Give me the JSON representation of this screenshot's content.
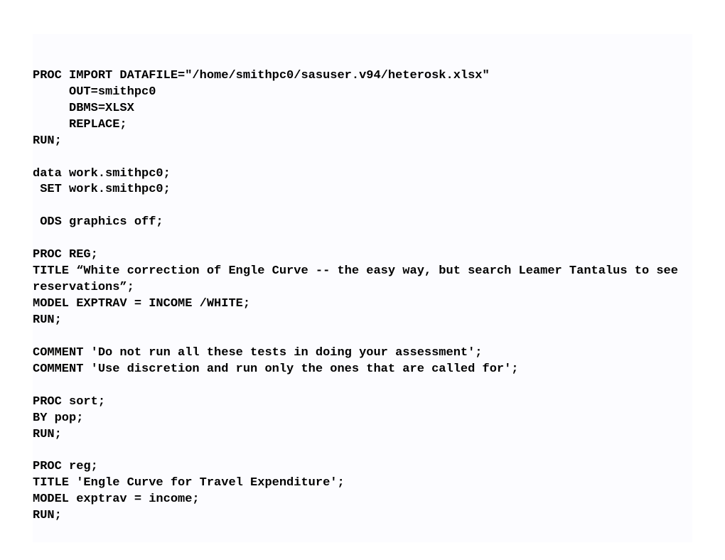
{
  "code": {
    "lines": [
      "PROC IMPORT DATAFILE=\"/home/smithpc0/sasuser.v94/heterosk.xlsx\"",
      "     OUT=smithpc0",
      "     DBMS=XLSX",
      "     REPLACE;",
      "RUN;",
      "",
      "data work.smithpc0;",
      " SET work.smithpc0;",
      "",
      " ODS graphics off;",
      "",
      "PROC REG;",
      "TITLE “White correction of Engle Curve -- the easy way, but search Leamer Tantalus to see reservations”;",
      "MODEL EXPTRAV = INCOME /WHITE;",
      "RUN;",
      "",
      "COMMENT 'Do not run all these tests in doing your assessment';",
      "COMMENT 'Use discretion and run only the ones that are called for';",
      "",
      "PROC sort;",
      "BY pop;",
      "RUN;",
      "",
      "PROC reg;",
      "TITLE 'Engle Curve for Travel Expenditure';",
      "MODEL exptrav = income;",
      "RUN;"
    ]
  }
}
